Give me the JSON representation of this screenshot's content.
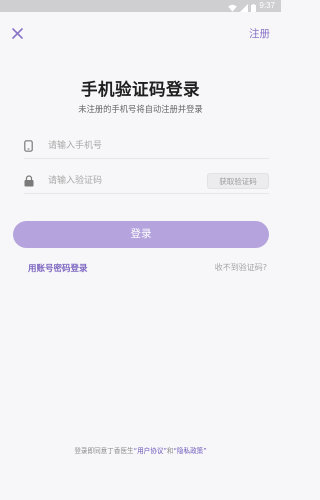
{
  "status_bar": {
    "time": "9:37",
    "icons": [
      "wifi-icon",
      "signal-icon",
      "battery-icon"
    ]
  },
  "header": {
    "close_icon": "close-icon",
    "register_label": "注册"
  },
  "title": "手机验证码登录",
  "subtitle": "未注册的手机号将自动注册并登录",
  "form": {
    "phone": {
      "icon": "phone-icon",
      "placeholder": "请输入手机号",
      "value": ""
    },
    "code": {
      "icon": "lock-icon",
      "placeholder": "请输入验证码",
      "value": ""
    },
    "get_code_label": "获取验证码"
  },
  "login_label": "登录",
  "links": {
    "password_login": "用账号密码登录",
    "no_code": "收不到验证码?"
  },
  "footer": {
    "prefix": "登录即同意丁香医生",
    "agreement": "“用户协议”",
    "and": "和",
    "privacy": "“隐私政策”"
  },
  "colors": {
    "accent": "#8a74c8",
    "login_button": "#b4a3dc",
    "background": "#f7f7f9",
    "status_bar": "#cfcfd2"
  }
}
